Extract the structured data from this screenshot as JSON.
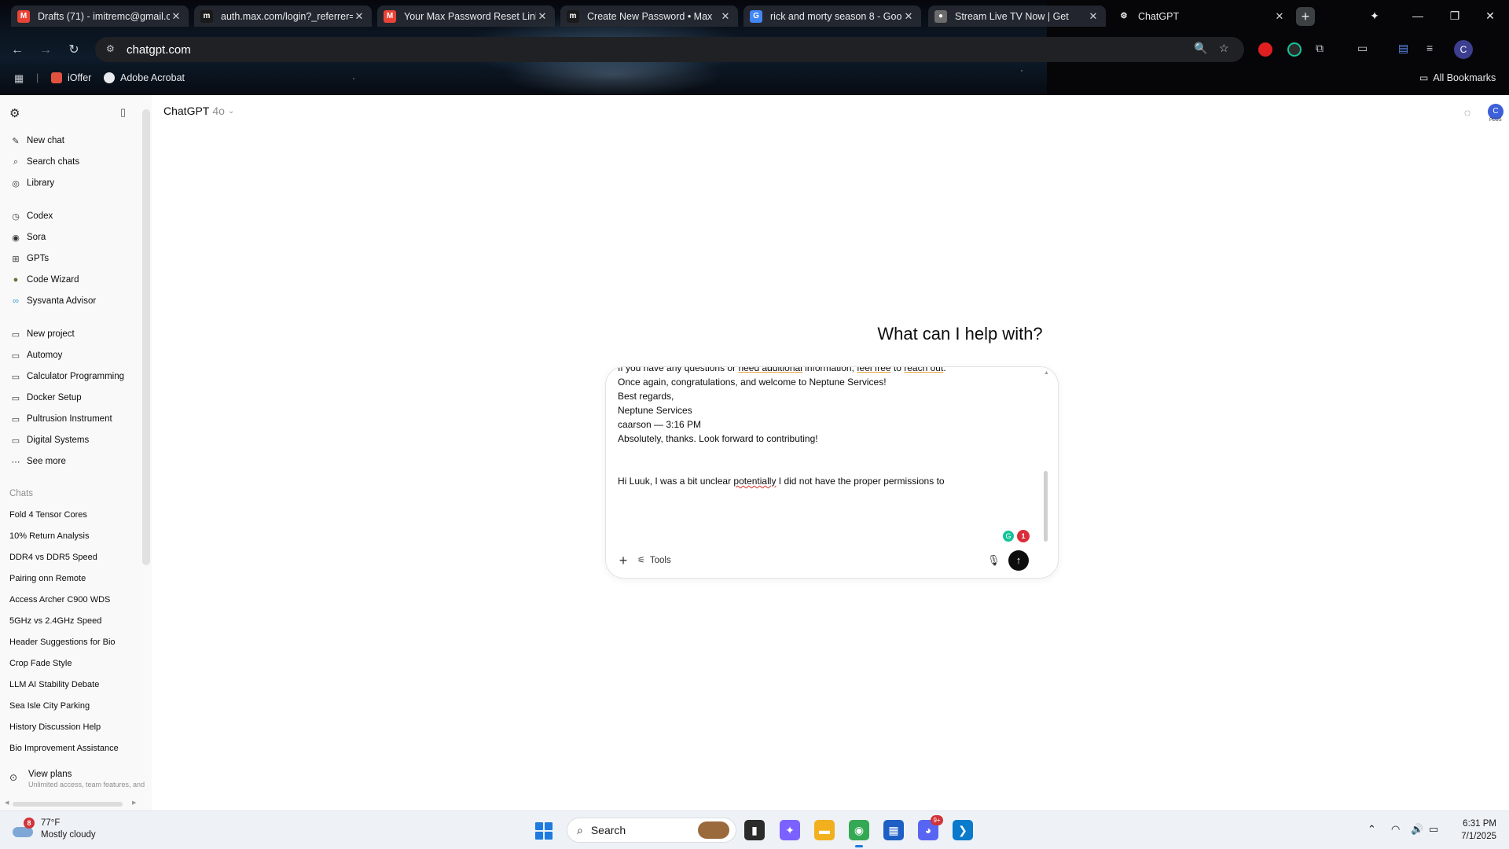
{
  "browser": {
    "tabs": [
      {
        "title": "Drafts (71) - imitremc@gmail.c",
        "favicon": "gmail-icon",
        "color": "#ea4335"
      },
      {
        "title": "auth.max.com/login?_referrer=",
        "favicon": "max-icon",
        "color": "#1a1a1a"
      },
      {
        "title": "Your Max Password Reset Link",
        "favicon": "gmail-icon",
        "color": "#ea4335"
      },
      {
        "title": "Create New Password • Max",
        "favicon": "max-icon",
        "color": "#1a1a1a"
      },
      {
        "title": "rick and morty season 8 - Goo",
        "favicon": "google-icon",
        "color": "#4285f4"
      },
      {
        "title": "Stream Live TV Now | Get",
        "favicon": "tv-icon",
        "color": "#6b6b6b"
      },
      {
        "title": "ChatGPT",
        "favicon": "chatgpt-icon",
        "color": "#ffffff"
      }
    ],
    "new_tab_label": "+",
    "url": "chatgpt.com",
    "profile_initial": "C",
    "bookmarks": [
      {
        "label": "iOffer",
        "icon": "ioffer-icon"
      },
      {
        "label": "Adobe Acrobat",
        "icon": "acrobat-icon"
      }
    ],
    "all_bookmarks_label": "All Bookmarks"
  },
  "sidebar": {
    "primary": [
      {
        "label": "New chat",
        "icon": "new-chat-icon"
      },
      {
        "label": "Search chats",
        "icon": "search-icon"
      },
      {
        "label": "Library",
        "icon": "library-icon"
      }
    ],
    "apps": [
      {
        "label": "Codex",
        "icon": "codex-icon"
      },
      {
        "label": "Sora",
        "icon": "sora-icon"
      },
      {
        "label": "GPTs",
        "icon": "gpts-icon"
      },
      {
        "label": "Code Wizard",
        "icon": "code-wizard-icon"
      },
      {
        "label": "Sysvanta Advisor",
        "icon": "sysvanta-icon"
      }
    ],
    "projects": [
      {
        "label": "New project",
        "icon": "folder-plus-icon"
      },
      {
        "label": "Automoy",
        "icon": "folder-icon"
      },
      {
        "label": "Calculator Programming",
        "icon": "folder-icon"
      },
      {
        "label": "Docker Setup",
        "icon": "folder-icon"
      },
      {
        "label": "Pultrusion Instrument",
        "icon": "folder-icon"
      },
      {
        "label": "Digital Systems",
        "icon": "folder-icon"
      },
      {
        "label": "See more",
        "icon": "more-icon"
      }
    ],
    "chats_label": "Chats",
    "chats": [
      "Fold 4 Tensor Cores",
      "10% Return Analysis",
      "DDR4 vs DDR5 Speed",
      "Pairing onn Remote",
      "Access Archer C900 WDS",
      "5GHz vs 2.4GHz Speed",
      "Header Suggestions for Bio",
      "Crop Fade Style",
      "LLM AI Stability Debate",
      "Sea Isle City Parking",
      "History Discussion Help",
      "Bio Improvement Assistance"
    ],
    "view_plans": {
      "title": "View plans",
      "subtitle": "Unlimited access, team features, and"
    }
  },
  "main": {
    "model_name": "ChatGPT",
    "model_version": "4o",
    "hero_text": "What can I help with?",
    "composer": {
      "lines": [
        {
          "parts": [
            {
              "text": "If you have any questions or ",
              "style": ""
            },
            {
              "text": "need additional",
              "style": "gram"
            },
            {
              "text": " information, ",
              "style": ""
            },
            {
              "text": "feel free",
              "style": "gram"
            },
            {
              "text": " to ",
              "style": ""
            },
            {
              "text": "reach out",
              "style": "gram"
            },
            {
              "text": ".",
              "style": ""
            }
          ]
        },
        {
          "parts": [
            {
              "text": "Once again, congratulations, and welcome to Neptune Services!",
              "style": ""
            }
          ]
        },
        {
          "parts": [
            {
              "text": "Best regards,",
              "style": ""
            }
          ]
        },
        {
          "parts": [
            {
              "text": "Neptune Services",
              "style": ""
            }
          ]
        },
        {
          "parts": [
            {
              "text": "caarson — 3:16 PM",
              "style": ""
            }
          ]
        },
        {
          "parts": [
            {
              "text": "Absolutely, thanks. Look forward to contributing!",
              "style": ""
            }
          ]
        },
        {
          "parts": [
            {
              "text": "",
              "style": ""
            }
          ]
        },
        {
          "parts": [
            {
              "text": "",
              "style": ""
            }
          ]
        },
        {
          "parts": [
            {
              "text": "Hi Luuk, I was a bit unclear ",
              "style": ""
            },
            {
              "text": "potentially",
              "style": "spell"
            },
            {
              "text": " I did not have the proper permissions to",
              "style": ""
            }
          ]
        }
      ],
      "grammarly_count": "1",
      "tools_label": "Tools",
      "add_label": "+",
      "send_label": "↑"
    }
  },
  "taskbar": {
    "weather_badge": "8",
    "temperature": "77°F",
    "condition": "Mostly cloudy",
    "search_label": "Search",
    "apps": [
      {
        "name": "file-explorer",
        "glyph": "▮",
        "color": "#2b2b2b"
      },
      {
        "name": "copilot",
        "glyph": "✦",
        "color": "#7b61ff"
      },
      {
        "name": "folder",
        "glyph": "▬",
        "color": "#f2b01e"
      },
      {
        "name": "chrome",
        "glyph": "◉",
        "color": "#34a853"
      },
      {
        "name": "store",
        "glyph": "▦",
        "color": "#1d5fc4"
      },
      {
        "name": "discord",
        "glyph": "◕",
        "color": "#5865f2",
        "badge": "9+"
      },
      {
        "name": "vscode",
        "glyph": "❯",
        "color": "#0a7acc"
      }
    ],
    "time": "6:31 PM",
    "date": "7/1/2025"
  }
}
